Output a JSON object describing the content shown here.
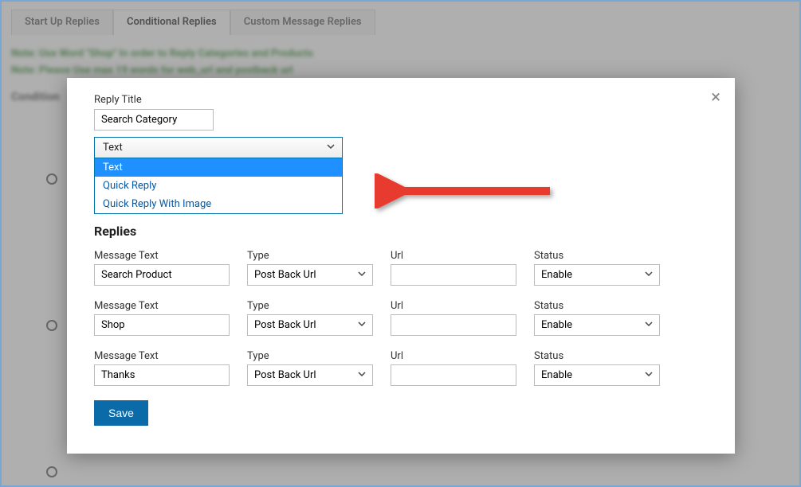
{
  "tabs": {
    "startup": "Start Up Replies",
    "conditional": "Conditional Replies",
    "custom": "Custom Message Replies"
  },
  "bg_hint_line1": "Note: Use Word \"Shop\" In order to Reply Categories and Products",
  "bg_hint_line2": "Note: Please Use max 19 words for web_url and postback url",
  "bg_section": "Condition",
  "modal": {
    "title_label": "Reply Title",
    "title_value": "Search Category",
    "dropdown_selected": "Text",
    "dropdown_options": {
      "opt0": "Text",
      "opt1": "Quick Reply",
      "opt2": "Quick Reply With Image"
    },
    "section_heading": "Replies",
    "columns": {
      "message": "Message Text",
      "type": "Type",
      "url": "Url",
      "status": "Status"
    },
    "rows": [
      {
        "message": "Search Product",
        "type": "Post Back Url",
        "url": "",
        "status": "Enable"
      },
      {
        "message": "Shop",
        "type": "Post Back Url",
        "url": "",
        "status": "Enable"
      },
      {
        "message": "Thanks",
        "type": "Post Back Url",
        "url": "",
        "status": "Enable"
      }
    ],
    "save_label": "Save"
  },
  "icons": {
    "close": "×"
  }
}
